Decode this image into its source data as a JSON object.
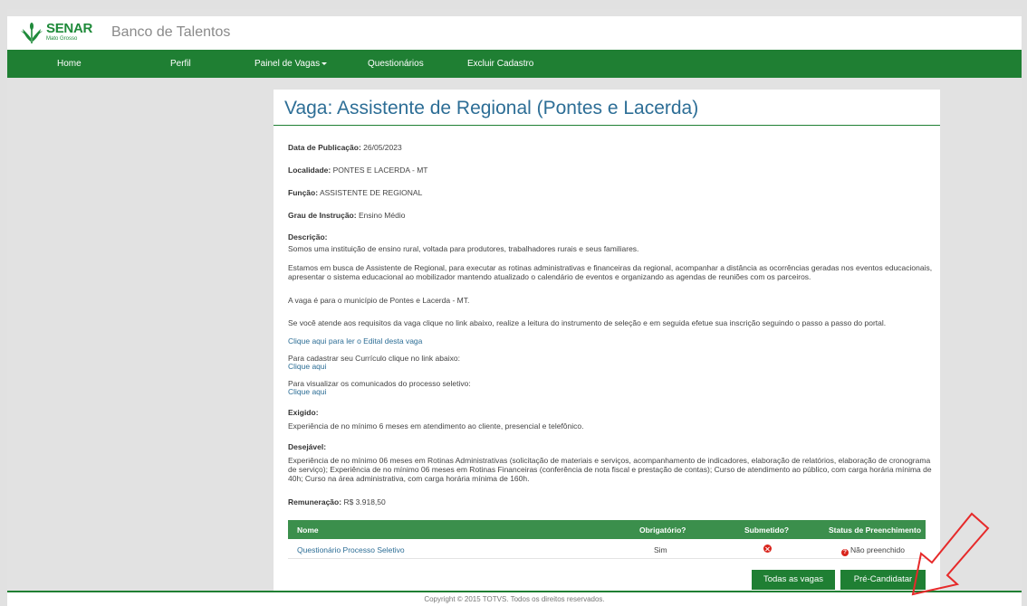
{
  "app": {
    "brand": "SENAR",
    "brand_sub": "Mato Grosso",
    "title": "Banco de Talentos"
  },
  "nav": {
    "home": "Home",
    "perfil": "Perfil",
    "painel": "Painel de Vagas",
    "questionarios": "Questionários",
    "excluir": "Excluir Cadastro"
  },
  "job": {
    "title": "Vaga: Assistente de Regional (Pontes e Lacerda)",
    "pub_label": "Data de Publicação:",
    "pub_value": "26/05/2023",
    "loc_label": "Localidade:",
    "loc_value": "PONTES E LACERDA - MT",
    "func_label": "Função:",
    "func_value": "ASSISTENTE DE REGIONAL",
    "grau_label": "Grau de Instrução:",
    "grau_value": "Ensino Médio",
    "desc_label": "Descrição:",
    "desc_p1": "Somos uma instituição de ensino rural, voltada para produtores, trabalhadores rurais e seus familiares.",
    "desc_p2": "Estamos em busca de Assistente de Regional, para executar as rotinas administrativas e financeiras da regional, acompanhar a distância as ocorrências geradas nos eventos educacionais, apresentar o sistema educacional ao mobilizador mantendo atualizado o calendário de eventos e organizando as agendas de reuniões com os parceiros.",
    "desc_p3": "A vaga é para o município de Pontes e Lacerda - MT.",
    "desc_p4": "Se você atende aos requisitos da vaga clique no link abaixo, realize a leitura do instrumento de seleção e em seguida efetue sua inscrição seguindo o passo a passo do portal.",
    "edital_link": "Clique aqui para ler o Edital desta vaga",
    "curriculo_text": "Para cadastrar seu Currículo clique no link abaixo:",
    "curriculo_link": "Clique aqui",
    "comunicados_text": "Para visualizar os comunicados do processo seletivo:",
    "comunicados_link": "Clique aqui",
    "exigido_label": "Exigido:",
    "exigido_text": "Experiência de no mínimo 6 meses em atendimento ao cliente, presencial e telefônico.",
    "desejavel_label": "Desejável:",
    "desejavel_text": "Experiência de no mínimo 06 meses em Rotinas Administrativas (solicitação de materiais e serviços, acompanhamento de indicadores, elaboração de relatórios, elaboração de cronograma de serviço); Experiência de no mínimo 06 meses em Rotinas Financeiras (conferência de nota fiscal e prestação de contas); Curso de atendimento ao público, com carga horária mínima de 40h; Curso na área administrativa, com carga horária mínima de 160h.",
    "rem_label": "Remuneração:",
    "rem_value": "R$ 3.918,50"
  },
  "table": {
    "headers": [
      "Nome",
      "Obrigatório?",
      "Submetido?",
      "Status de Preenchimento"
    ],
    "rows": [
      {
        "nome": "Questionário Processo Seletivo",
        "obrigatorio": "Sim",
        "submetido_icon": "x-circle-icon",
        "status": "Não preenchido"
      }
    ]
  },
  "buttons": {
    "todas": "Todas as vagas",
    "pre": "Pré-Candidatar"
  },
  "footer": "Copyright © 2015 TOTVS. Todos os direitos reservados.",
  "colors": {
    "brand_green": "#1f7f33",
    "table_header": "#3b8f4c",
    "title_blue": "#2d6e96",
    "link_blue": "#2d6e96",
    "error_red": "#d9241c",
    "annotation_arrow": "#e62a2a"
  }
}
